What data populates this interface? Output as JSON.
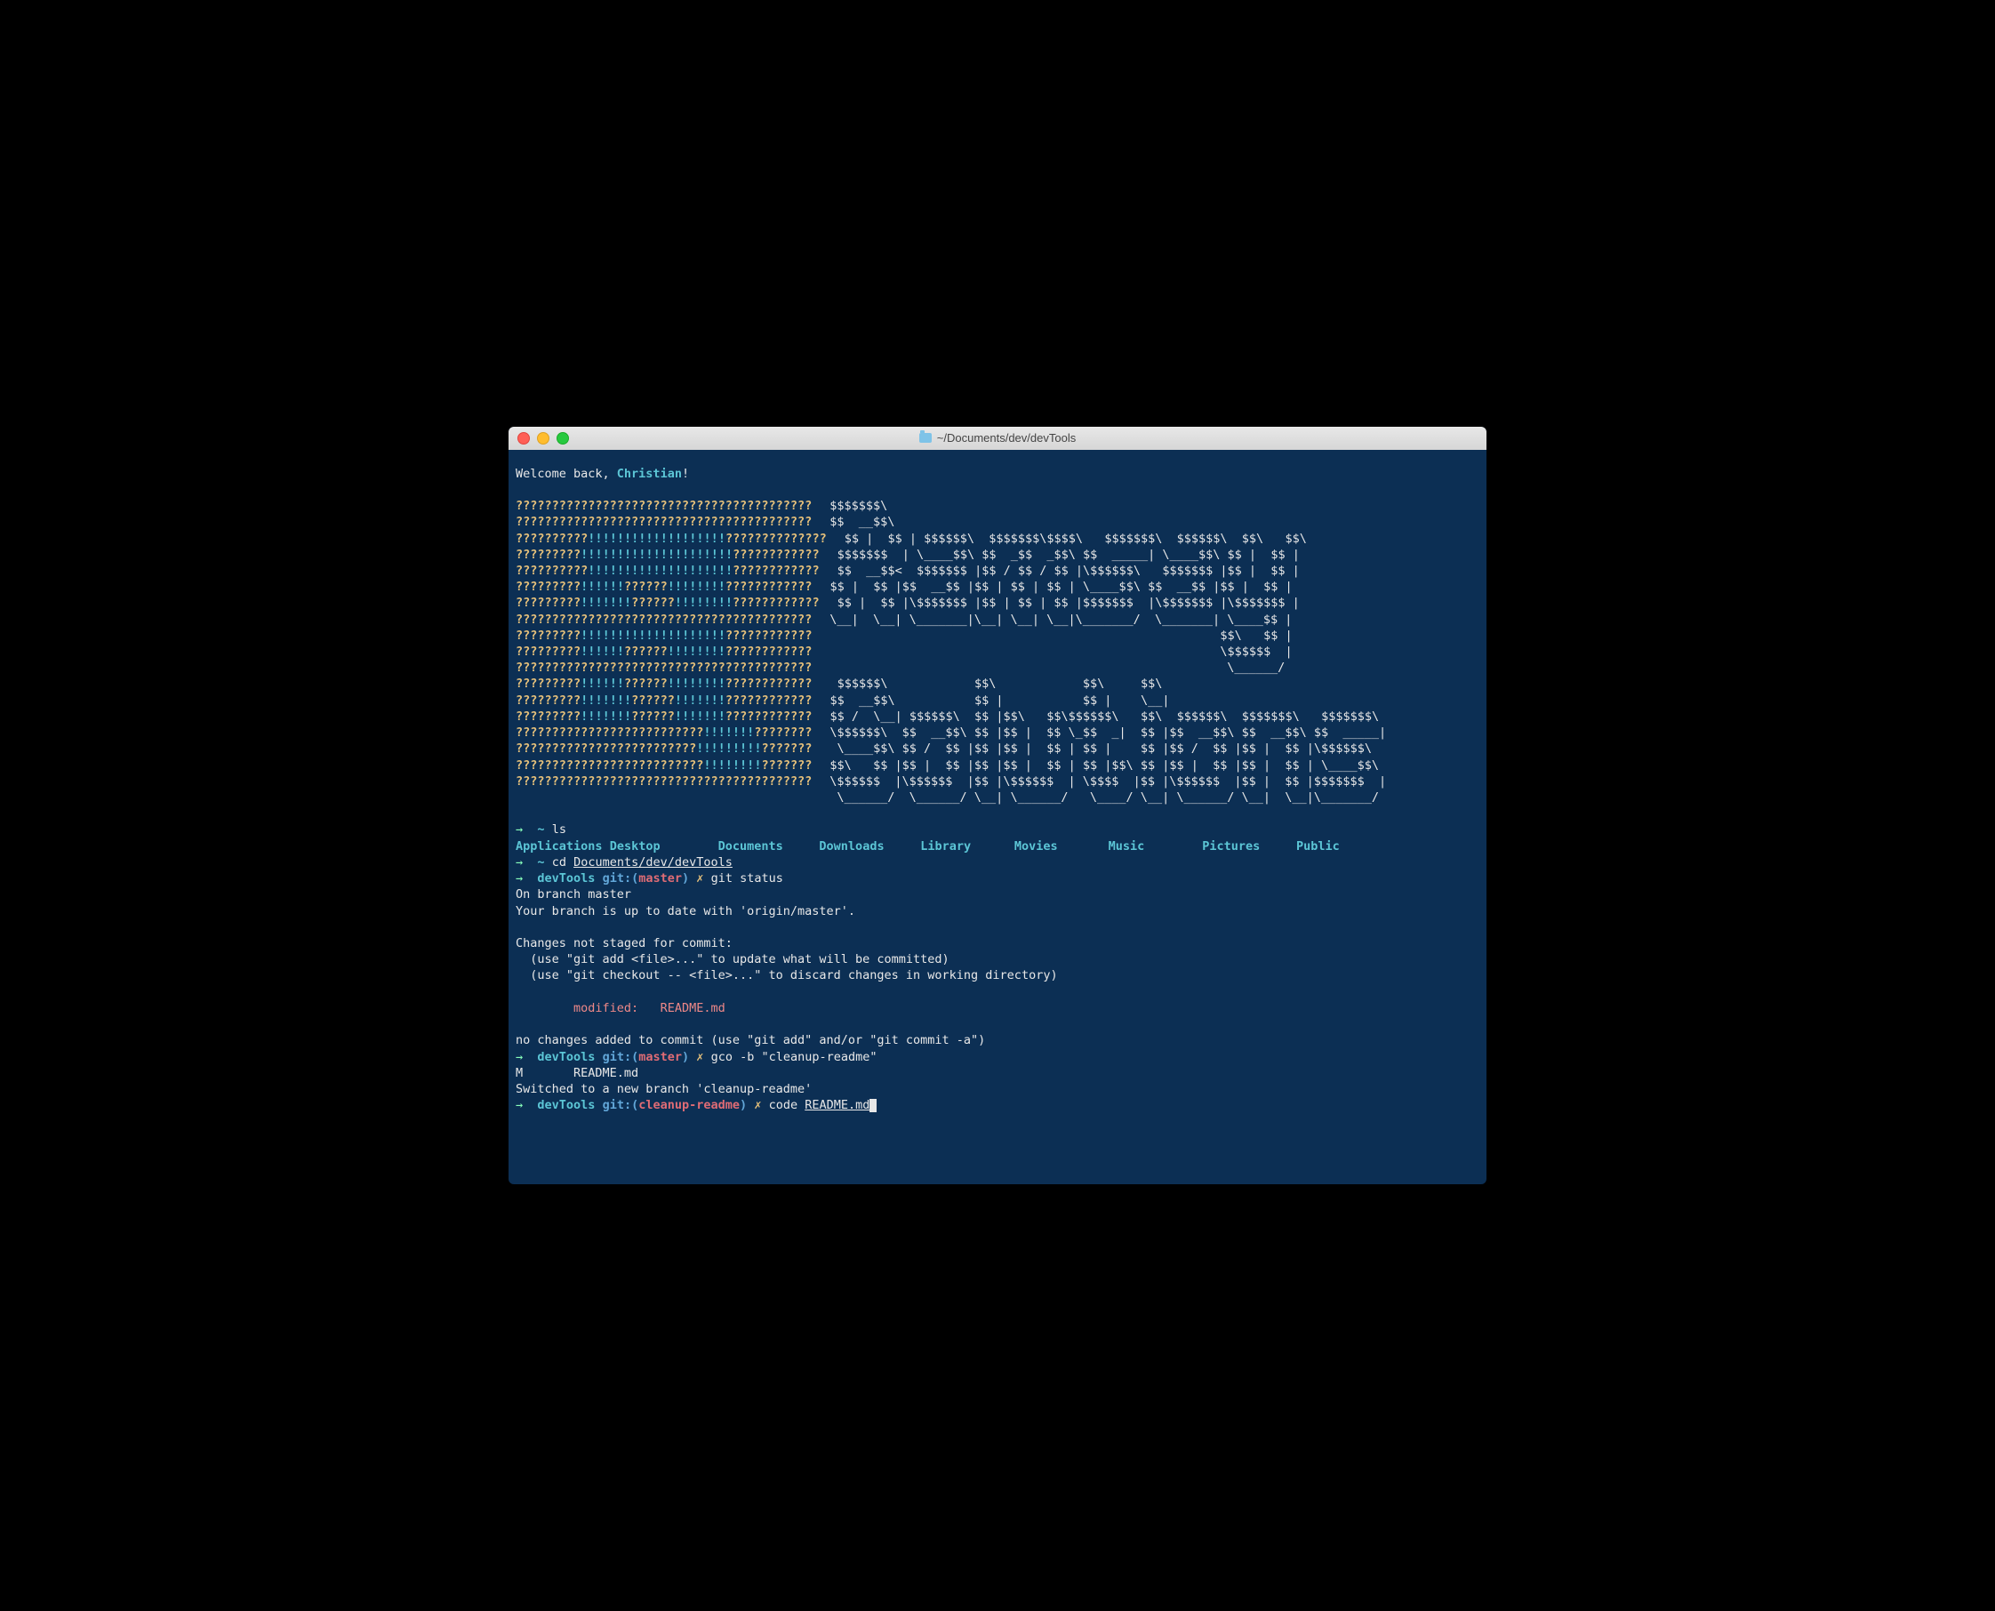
{
  "window": {
    "title": "~/Documents/dev/devTools"
  },
  "welcome": {
    "prefix": "Welcome back, ",
    "name": "Christian",
    "suffix": "!"
  },
  "ascii_left": [
    "?????????????????????????????????????????",
    "?????????????????????????????????????????",
    "??????????!!!!!!!!!!!!!!!!!!!??????????????",
    "?????????!!!!!!!!!!!!!!!!!!!!!????????????",
    "??????????!!!!!!!!!!!!!!!!!!!!????????????",
    "?????????!!!!!!??????!!!!!!!!????????????",
    "?????????!!!!!!!??????!!!!!!!!????????????",
    "?????????????????????????????????????????",
    "?????????!!!!!!!!!!!!!!!!!!!!????????????",
    "?????????!!!!!!??????!!!!!!!!????????????",
    "?????????????????????????????????????????",
    "?????????!!!!!!??????!!!!!!!!????????????",
    "?????????!!!!!!!??????!!!!!!!????????????",
    "?????????!!!!!!!??????!!!!!!!????????????",
    "??????????????????????????!!!!!!!????????",
    "?????????????????????????!!!!!!!!!???????",
    "??????????????????????????!!!!!!!!???????",
    "?????????????????????????????????????????"
  ],
  "ascii_right": [
    "$$$$$$$\\",
    "$$  __$$\\",
    "$$ |  $$ | $$$$$$\\  $$$$$$$\\$$$$\\   $$$$$$$\\  $$$$$$\\  $$\\   $$\\",
    "$$$$$$$  | \\____$$\\ $$  _$$  _$$\\ $$  _____| \\____$$\\ $$ |  $$ |",
    "$$  __$$<  $$$$$$$ |$$ / $$ / $$ |\\$$$$$$\\   $$$$$$$ |$$ |  $$ |",
    "$$ |  $$ |$$  __$$ |$$ | $$ | $$ | \\____$$\\ $$  __$$ |$$ |  $$ |",
    "$$ |  $$ |\\$$$$$$$ |$$ | $$ | $$ |$$$$$$$  |\\$$$$$$$ |\\$$$$$$$ |",
    "\\__|  \\__| \\_______|\\__| \\__| \\__|\\_______/  \\_______| \\____$$ |",
    "                                                      $$\\   $$ |",
    "                                                      \\$$$$$$  |",
    "                                                       \\______/",
    " $$$$$$\\            $$\\            $$\\     $$\\",
    "$$  __$$\\           $$ |           $$ |    \\__|",
    "$$ /  \\__| $$$$$$\\  $$ |$$\\   $$\\$$$$$$\\   $$\\  $$$$$$\\  $$$$$$$\\   $$$$$$$\\",
    "\\$$$$$$\\  $$  __$$\\ $$ |$$ |  $$ \\_$$  _|  $$ |$$  __$$\\ $$  __$$\\ $$  _____|",
    " \\____$$\\ $$ /  $$ |$$ |$$ |  $$ | $$ |    $$ |$$ /  $$ |$$ |  $$ |\\$$$$$$\\",
    "$$\\   $$ |$$ |  $$ |$$ |$$ |  $$ | $$ |$$\\ $$ |$$ |  $$ |$$ |  $$ | \\____$$\\",
    "\\$$$$$$  |\\$$$$$$  |$$ |\\$$$$$$  | \\$$$$  |$$ |\\$$$$$$  |$$ |  $$ |$$$$$$$  |",
    " \\______/  \\______/ \\__| \\______/   \\____/ \\__| \\______/ \\__|  \\__|\\_______/"
  ],
  "prompt1": {
    "arrow": "→",
    "dir": "~",
    "cmd": "ls"
  },
  "ls_output": [
    "Applications",
    "Desktop",
    "Documents",
    "Downloads",
    "Library",
    "Movies",
    "Music",
    "Pictures",
    "Public"
  ],
  "prompt2": {
    "arrow": "→",
    "dir": "~",
    "cmd": "cd ",
    "path": "Documents/dev/devTools"
  },
  "prompt3": {
    "arrow": "→",
    "dir": "devTools",
    "git_label": "git:",
    "branch": "master",
    "dirty": "✗",
    "cmd": "git status"
  },
  "git_status": {
    "line1": "On branch master",
    "line2": "Your branch is up to date with 'origin/master'.",
    "line3": "Changes not staged for commit:",
    "line4": "  (use \"git add <file>...\" to update what will be committed)",
    "line5": "  (use \"git checkout -- <file>...\" to discard changes in working directory)",
    "modified_label": "        modified:   ",
    "modified_file": "README.md",
    "line6": "no changes added to commit (use \"git add\" and/or \"git commit -a\")"
  },
  "prompt4": {
    "arrow": "→",
    "dir": "devTools",
    "git_label": "git:",
    "branch": "master",
    "dirty": "✗",
    "cmd": "gco -b \"cleanup-readme\""
  },
  "gco_output": {
    "line1": "M       README.md",
    "line2": "Switched to a new branch 'cleanup-readme'"
  },
  "prompt5": {
    "arrow": "→",
    "dir": "devTools",
    "git_label": "git:",
    "branch": "cleanup-readme",
    "dirty": "✗",
    "cmd": "code ",
    "arg": "README.md"
  }
}
